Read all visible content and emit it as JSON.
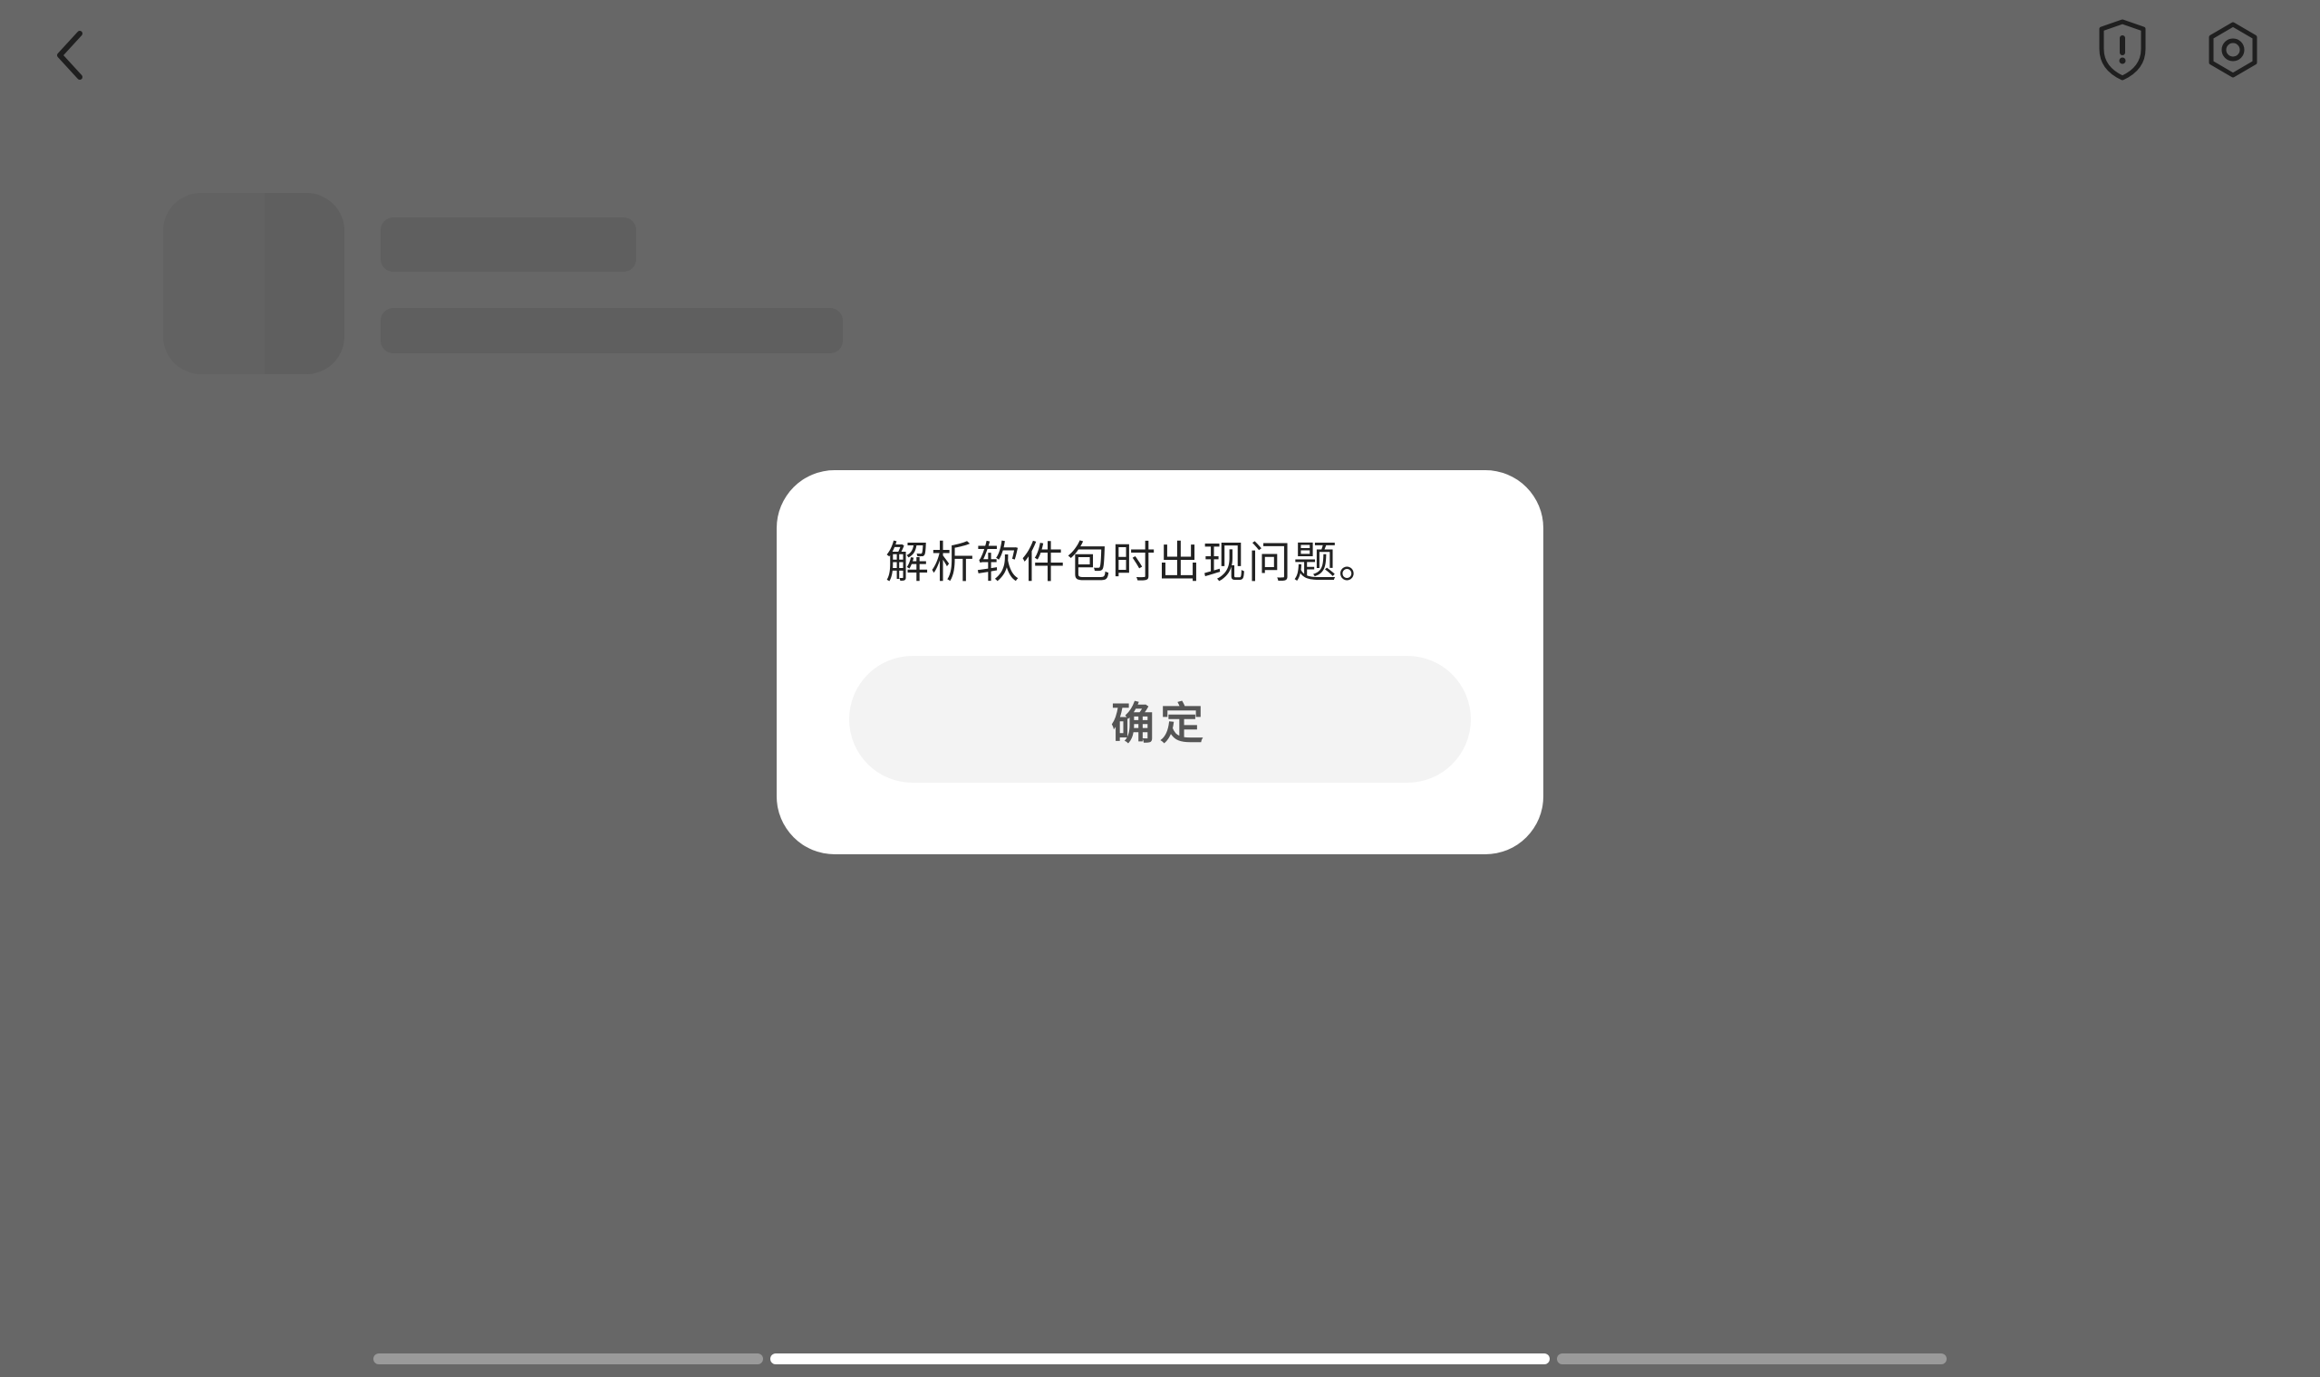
{
  "header": {
    "back_icon": "chevron-left-icon",
    "shield_icon": "shield-alert-icon",
    "settings_icon": "hexagon-settings-icon"
  },
  "dialog": {
    "message": "解析软件包时出现问题。",
    "confirm_label": "确定"
  },
  "colors": {
    "overlay_background": "#676767",
    "dialog_background": "#ffffff",
    "button_background": "#f3f3f3",
    "active_indicator": "#ffffff"
  },
  "pager": {
    "current_page": 2,
    "total_pages": 3
  }
}
